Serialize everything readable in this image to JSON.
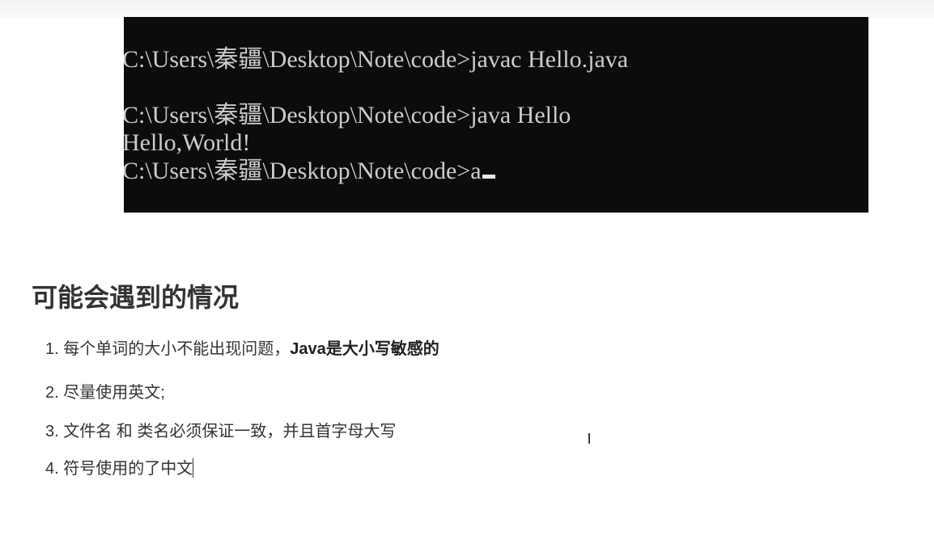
{
  "terminal": {
    "lines": [
      "C:\\Users\\秦疆\\Desktop\\Note\\code>javac Hello.java",
      "",
      "C:\\Users\\秦疆\\Desktop\\Note\\code>java Hello",
      "Hello,World!",
      "C:\\Users\\秦疆\\Desktop\\Note\\code>a"
    ]
  },
  "section": {
    "heading": "可能会遇到的情况",
    "items": [
      {
        "number": "1.",
        "text": "每个单词的大小不能出现问题，",
        "bold": "Java是大小写敏感的"
      },
      {
        "number": "2.",
        "text": "尽量使用英文;"
      },
      {
        "number": "3.",
        "text": "文件名 和 类名必须保证一致，并且首字母大写"
      },
      {
        "number": "4.",
        "text": "符号使用的了中文"
      }
    ]
  },
  "icons": {
    "cursor": "text-cursor-icon"
  }
}
